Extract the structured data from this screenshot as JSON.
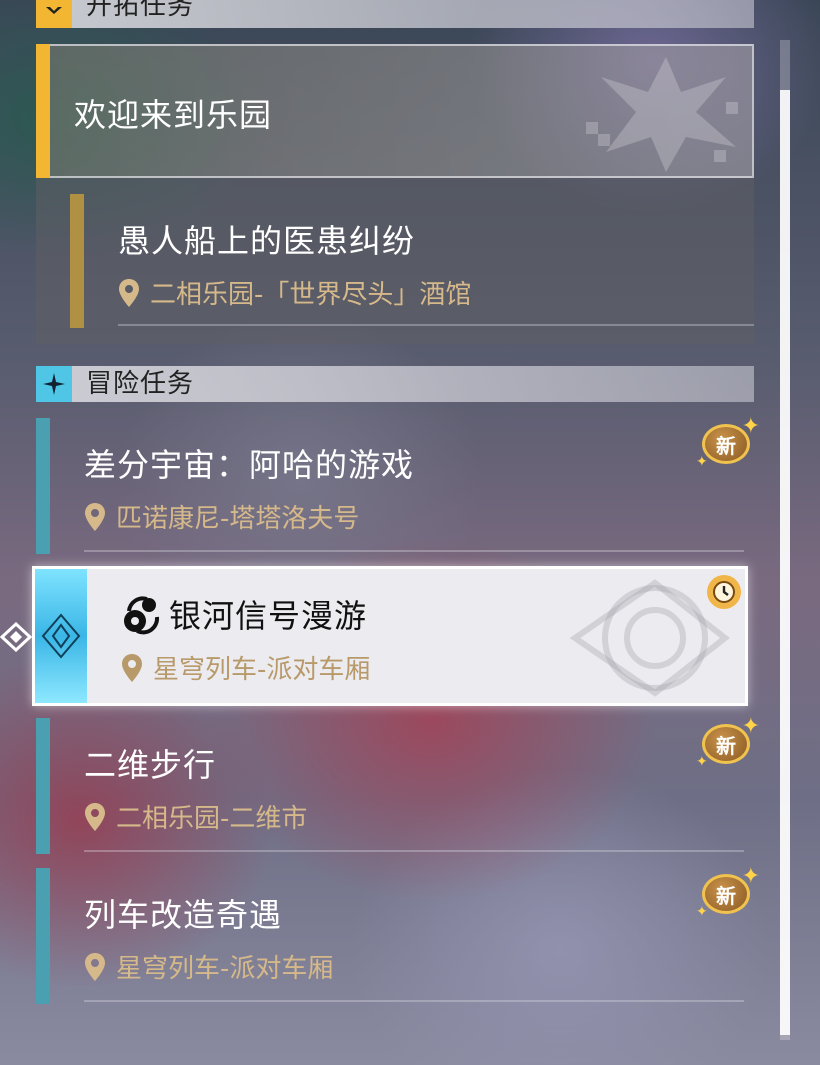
{
  "sections": {
    "trailblaze": {
      "title": "开拓任务"
    },
    "adventure": {
      "title": "冒险任务"
    }
  },
  "trailblaze_quests": {
    "main": {
      "title": "欢迎来到乐园"
    },
    "sub": {
      "title": "愚人船上的医患纠纷",
      "location": "二相乐园-「世界尽头」酒馆"
    }
  },
  "adventure_quests": [
    {
      "title": "差分宇宙：阿哈的游戏",
      "location": "匹诺康尼-塔塔洛夫号",
      "badge": "新"
    },
    {
      "title": "银河信号漫游",
      "location": "星穹列车-派对车厢",
      "selected": true
    },
    {
      "title": "二维步行",
      "location": "二相乐园-二维市",
      "badge": "新"
    },
    {
      "title": "列车改造奇遇",
      "location": "星穹列车-派对车厢",
      "badge": "新"
    }
  ],
  "colors": {
    "trailblaze_accent": "#f2b632",
    "adventure_accent": "#4a9fb0",
    "location_text": "#d6b98a",
    "selected_bg": "#ecebef"
  },
  "icons": [
    "trailblaze-icon",
    "adventure-icon",
    "location-pin-icon",
    "new-badge-icon",
    "clock-icon",
    "signal-icon",
    "selection-arrow-icon",
    "scrollbar"
  ]
}
